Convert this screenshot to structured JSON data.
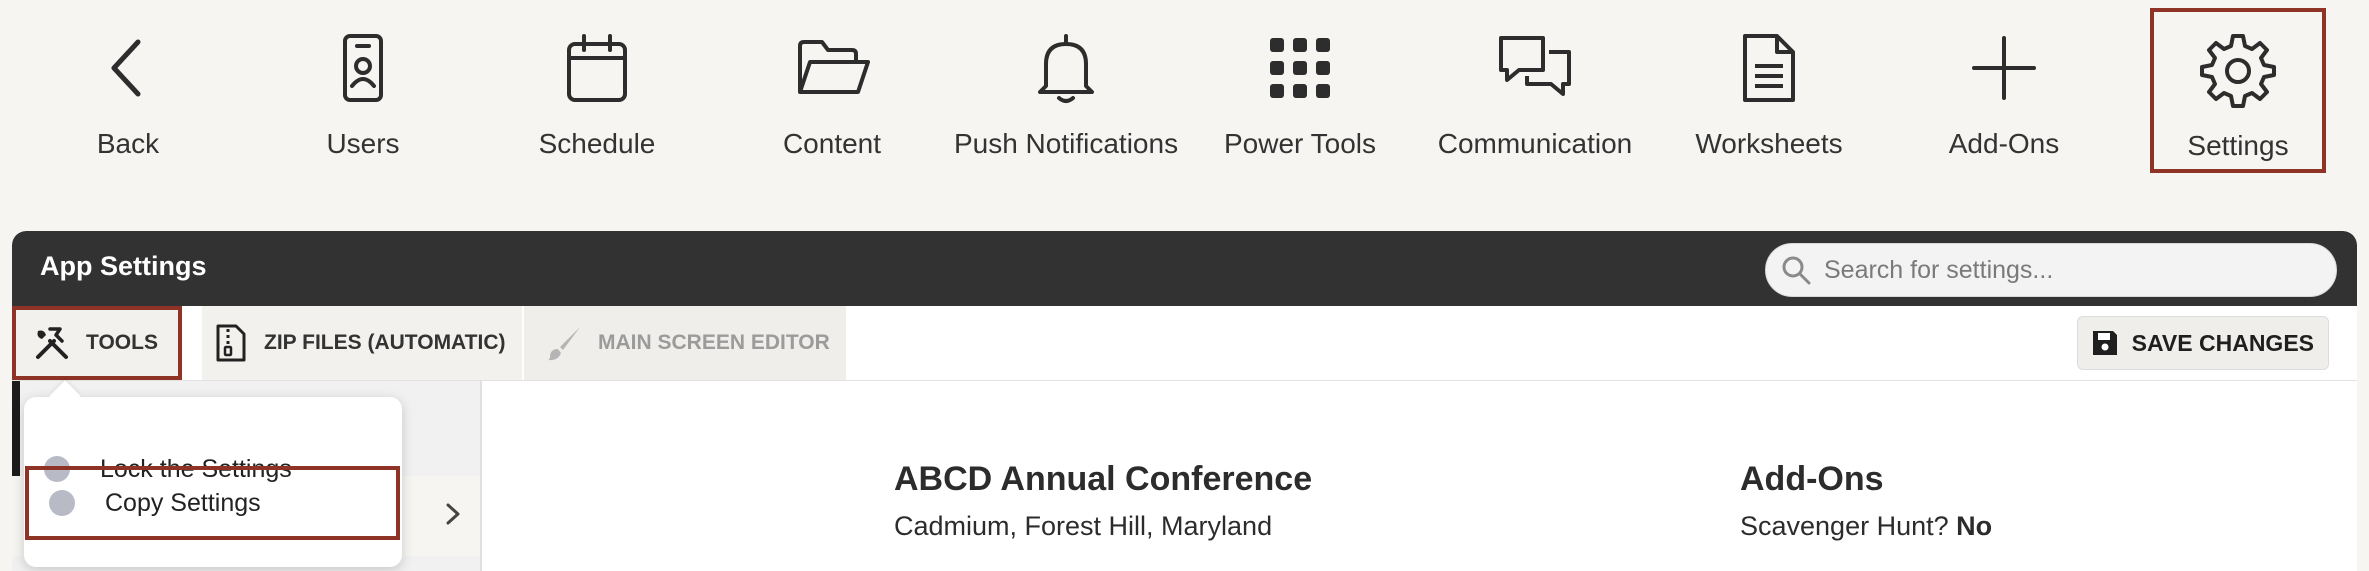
{
  "nav": {
    "items": [
      {
        "label": "Back",
        "icon": "back-icon"
      },
      {
        "label": "Users",
        "icon": "user-badge-icon"
      },
      {
        "label": "Schedule",
        "icon": "calendar-icon"
      },
      {
        "label": "Content",
        "icon": "folder-icon"
      },
      {
        "label": "Push Notifications",
        "icon": "bell-icon"
      },
      {
        "label": "Power Tools",
        "icon": "grid-icon"
      },
      {
        "label": "Communication",
        "icon": "chat-icon"
      },
      {
        "label": "Worksheets",
        "icon": "document-icon"
      },
      {
        "label": "Add-Ons",
        "icon": "plus-icon"
      },
      {
        "label": "Settings",
        "icon": "gear-icon"
      }
    ],
    "active": "Settings"
  },
  "panel": {
    "title": "App Settings",
    "search_placeholder": "Search for settings..."
  },
  "toolbar": {
    "tools_label": "TOOLS",
    "zip_label": "ZIP FILES (AUTOMATIC)",
    "main_screen_label": "MAIN SCREEN EDITOR",
    "save_label": "SAVE CHANGES"
  },
  "tools_menu": {
    "items": [
      {
        "label": "Lock the Settings"
      },
      {
        "label": "Copy Settings"
      }
    ]
  },
  "main": {
    "event_title": "ABCD Annual Conference",
    "event_location": "Cadmium, Forest Hill, Maryland",
    "addons_title": "Add-Ons",
    "scavenger_label": "Scavenger Hunt?",
    "scavenger_value": "No"
  },
  "colors": {
    "highlight": "#8f3326",
    "header_bg": "#323232",
    "page_bg": "#f6f5f2"
  }
}
